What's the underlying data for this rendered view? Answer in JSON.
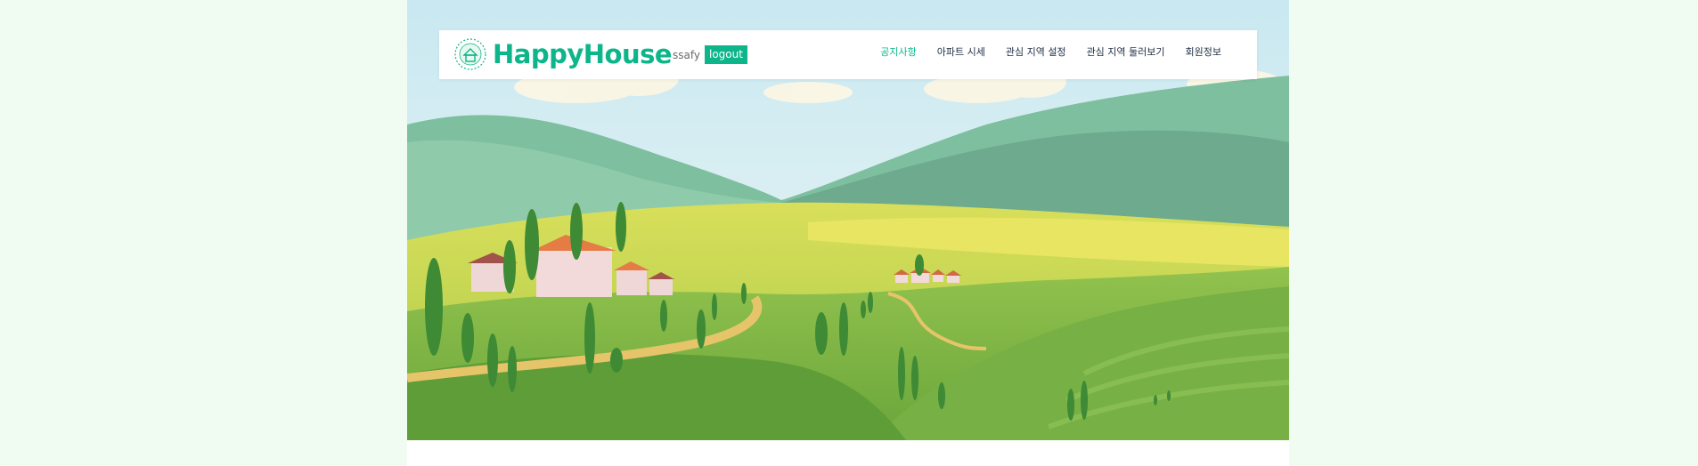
{
  "colors": {
    "brand": "#0db58a",
    "page_background": "#f0fcf2",
    "nav_text": "#223044"
  },
  "header": {
    "brand_name": "HappyHouse",
    "logo_icon": "house-logo-icon",
    "user": "ssafy",
    "logout_label": "logout"
  },
  "nav": {
    "items": [
      {
        "label": "공지사항",
        "active": true
      },
      {
        "label": "아파트 시세",
        "active": false
      },
      {
        "label": "관심 지역 설정",
        "active": false
      },
      {
        "label": "관심 지역 둘러보기",
        "active": false
      },
      {
        "label": "회원정보",
        "active": false
      }
    ]
  },
  "hero": {
    "image": "countryside-village-landscape-illustration"
  }
}
